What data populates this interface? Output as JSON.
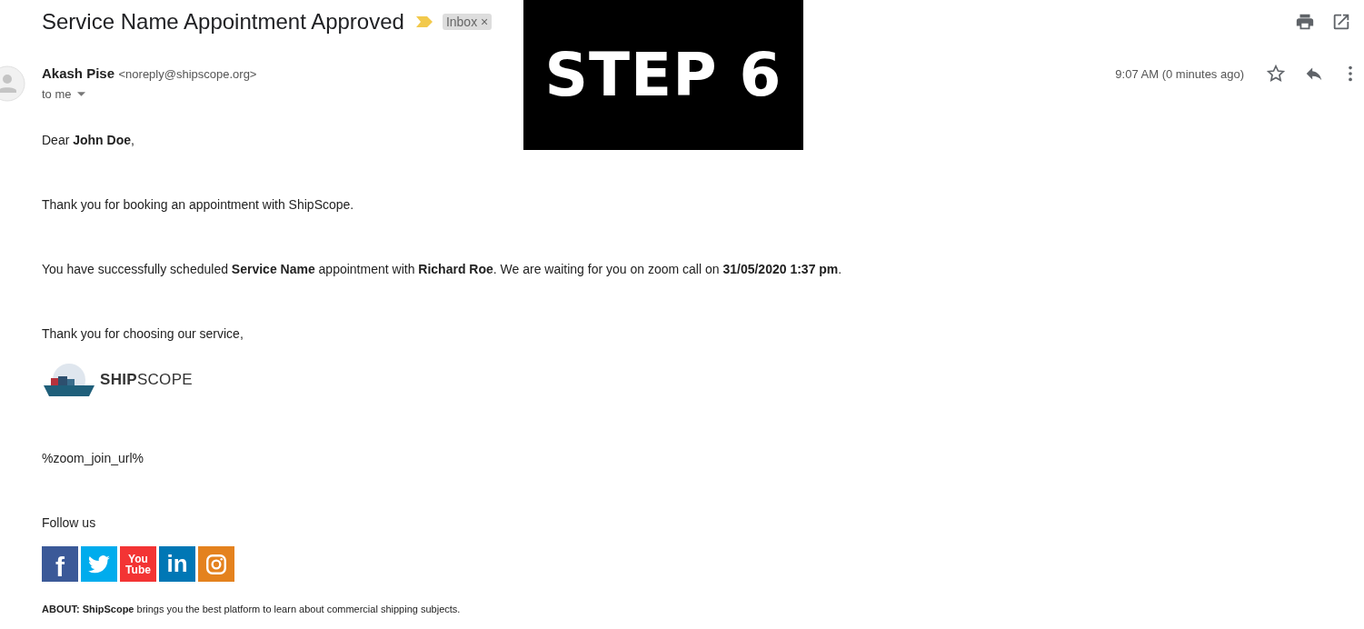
{
  "subject": "Service Name Appointment Approved",
  "important": true,
  "label": {
    "text": "Inbox",
    "close": "×"
  },
  "overlay_label": "STEP 6",
  "sender": {
    "name": "Akash Pise",
    "email": "<noreply@shipscope.org>",
    "recipient": "to me"
  },
  "time": "9:07 AM (0 minutes ago)",
  "starred": false,
  "body": [
    "Dear **John Doe**,",
    "Thank you for booking an appointment with ShipScope.",
    "You have successfully scheduled **Service Name** appointment with **Richard Roe**. We are waiting for you on zoom call on **31/05/2020 1:37 pm**.",
    "Thank you for choosing our service,"
  ],
  "logo": {
    "bold": "SHIP",
    "light": "SCOPE"
  },
  "join_url": "%zoom_join_url%",
  "follow": "Follow us",
  "social": [
    {
      "kind": "facebook",
      "text": "f",
      "color": "#3b5998"
    },
    {
      "kind": "twitter",
      "color": "#00aced"
    },
    {
      "kind": "youtube",
      "text": "You",
      "text2": "Tube",
      "color": "#f33434"
    },
    {
      "kind": "linkedin",
      "text": "in",
      "color": "#0077b5"
    },
    {
      "kind": "instagram",
      "color": "#e4821e"
    }
  ],
  "about": "**ABOUT:** **ShipScope** brings you the best platform to learn about commercial shipping subjects."
}
